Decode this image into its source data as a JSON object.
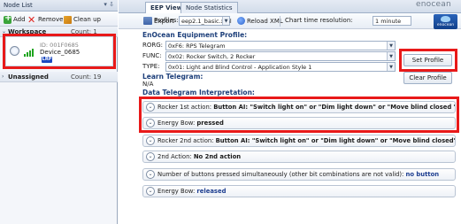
{
  "left_panel": {
    "title": "Node List",
    "pin": "▾ ⇩",
    "toolbar": {
      "add": "Add",
      "remove": "Remove",
      "clean": "Clean up"
    },
    "groups": [
      {
        "toggle": "⌄",
        "name": "Workspace",
        "count": "Count: 1"
      },
      {
        "toggle": "›",
        "name": "Unassigned",
        "count": "Count: 19"
      }
    ],
    "device": {
      "id": "ID: 001F0685",
      "name": "Device_0685",
      "badge": "LRP"
    }
  },
  "tabs": [
    "EEP View",
    "Node Statistics"
  ],
  "logo_text": "enocean",
  "toolbar": {
    "export": "Export",
    "profiles_label": "Profiles:",
    "profile_value": "eep2.1_basic.xml",
    "reload": "Reload XML",
    "resolution_label": "Chart time resolution:",
    "resolution_value": "1 minute",
    "brand": "enocean"
  },
  "eep": {
    "title": "EnOcean Equipment Profile:",
    "rows": [
      {
        "label": "RORG:",
        "value": "0xF6: RPS Telegram"
      },
      {
        "label": "FUNC:",
        "value": "0x02: Rocker Switch, 2 Rocker"
      },
      {
        "label": "TYPE:",
        "value": "0x01: Light and Blind Control - Application Style 1"
      }
    ],
    "set_profile": "Set Profile",
    "clear_profile": "Clear Profile"
  },
  "learn": {
    "title": "Learn Telegram:",
    "value": "N/A"
  },
  "data_title": "Data Telegram Interpretation:",
  "interpretations": [
    {
      "prefix": "Rocker 1st action: ",
      "bold": "Button AI:  \"Switch light on\" or \"Dim light down\" or \"Move blind closed \""
    },
    {
      "prefix": "Energy Bow: ",
      "bold": "pressed"
    },
    {
      "prefix": "Rocker 2nd action: ",
      "bold": "Button AI:  \"Switch light on\" or \"Dim light down\" or \"Move blind closed\""
    },
    {
      "prefix": "2nd Action: ",
      "bold": "No 2nd action"
    },
    {
      "prefix": "Number of buttons pressed simultaneously (other bit combinations are not valid): ",
      "blue": "no button"
    },
    {
      "prefix": "Energy Bow: ",
      "blue": "released"
    }
  ]
}
